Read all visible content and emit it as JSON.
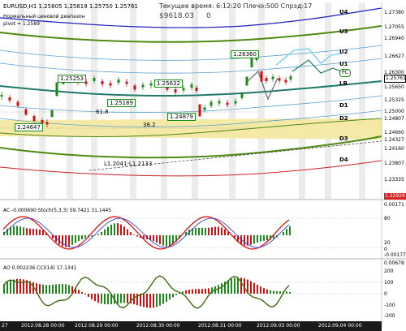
{
  "header": {
    "symbol_line": "EURUSD,H1  1.25805 1.25819 1.25750 1.25761",
    "subtitle_line1": "Нормальный ценовой диапазон",
    "subtitle_line2": "pivot = 1.2589",
    "time_label": "Текущее время: 6:12:20 Плечо:500 Спрэд:17",
    "balance": "$9618.03",
    "balance_suffix": "0"
  },
  "levels": [
    "U4",
    "U3",
    "U2",
    "U1",
    "LB",
    "D1",
    "D2",
    "D3",
    "D4"
  ],
  "annotations": {
    "box1": "1.25253",
    "box2": "1.25189",
    "box3": "1.25632",
    "box4": "1.24879",
    "box5": "1.24647",
    "box6": "1.26360",
    "fib1": "61.8",
    "fib2": "38.2",
    "trend": "L1.2041-L1.2133",
    "pc_badge": "PC"
  },
  "price_axis": [
    "1.27380",
    "1.27055",
    "1.26940",
    "1.26627",
    "1.26300",
    "1.25761",
    "1.25650",
    "1.25325",
    "1.25000",
    "1.24807",
    "1.24660",
    "1.24327",
    "1.24160",
    "1.23807",
    "1.23335"
  ],
  "current_price": "1.25761",
  "bottom_price": "1.22926",
  "ac": {
    "label": "AC -0.000690  Stoch(5,3,3) 59.7421 31.1445",
    "axis": [
      "0.00171",
      "80",
      "20",
      "0",
      "-0.00177"
    ]
  },
  "ao": {
    "label": "AO 0.002236  CCI(14) 17.1341",
    "axis": [
      "0.00678",
      "200",
      "100",
      "0",
      "-100",
      "-200"
    ]
  },
  "x_axis": [
    "27",
    "2012.08.28 00:00",
    "2012.08.29 00:00",
    "2012.08.30 00:00",
    "2012.08.31 00:00",
    "2012.09.03 00:00",
    "2012.09.04 00:00"
  ],
  "colors": {
    "green_line": "#4e8a12",
    "blue_line": "#2020c0",
    "red_line": "#cc2222",
    "zone": "#f5e9a8",
    "up_candle": "#1a8a1a",
    "down_candle": "#d01010"
  }
}
